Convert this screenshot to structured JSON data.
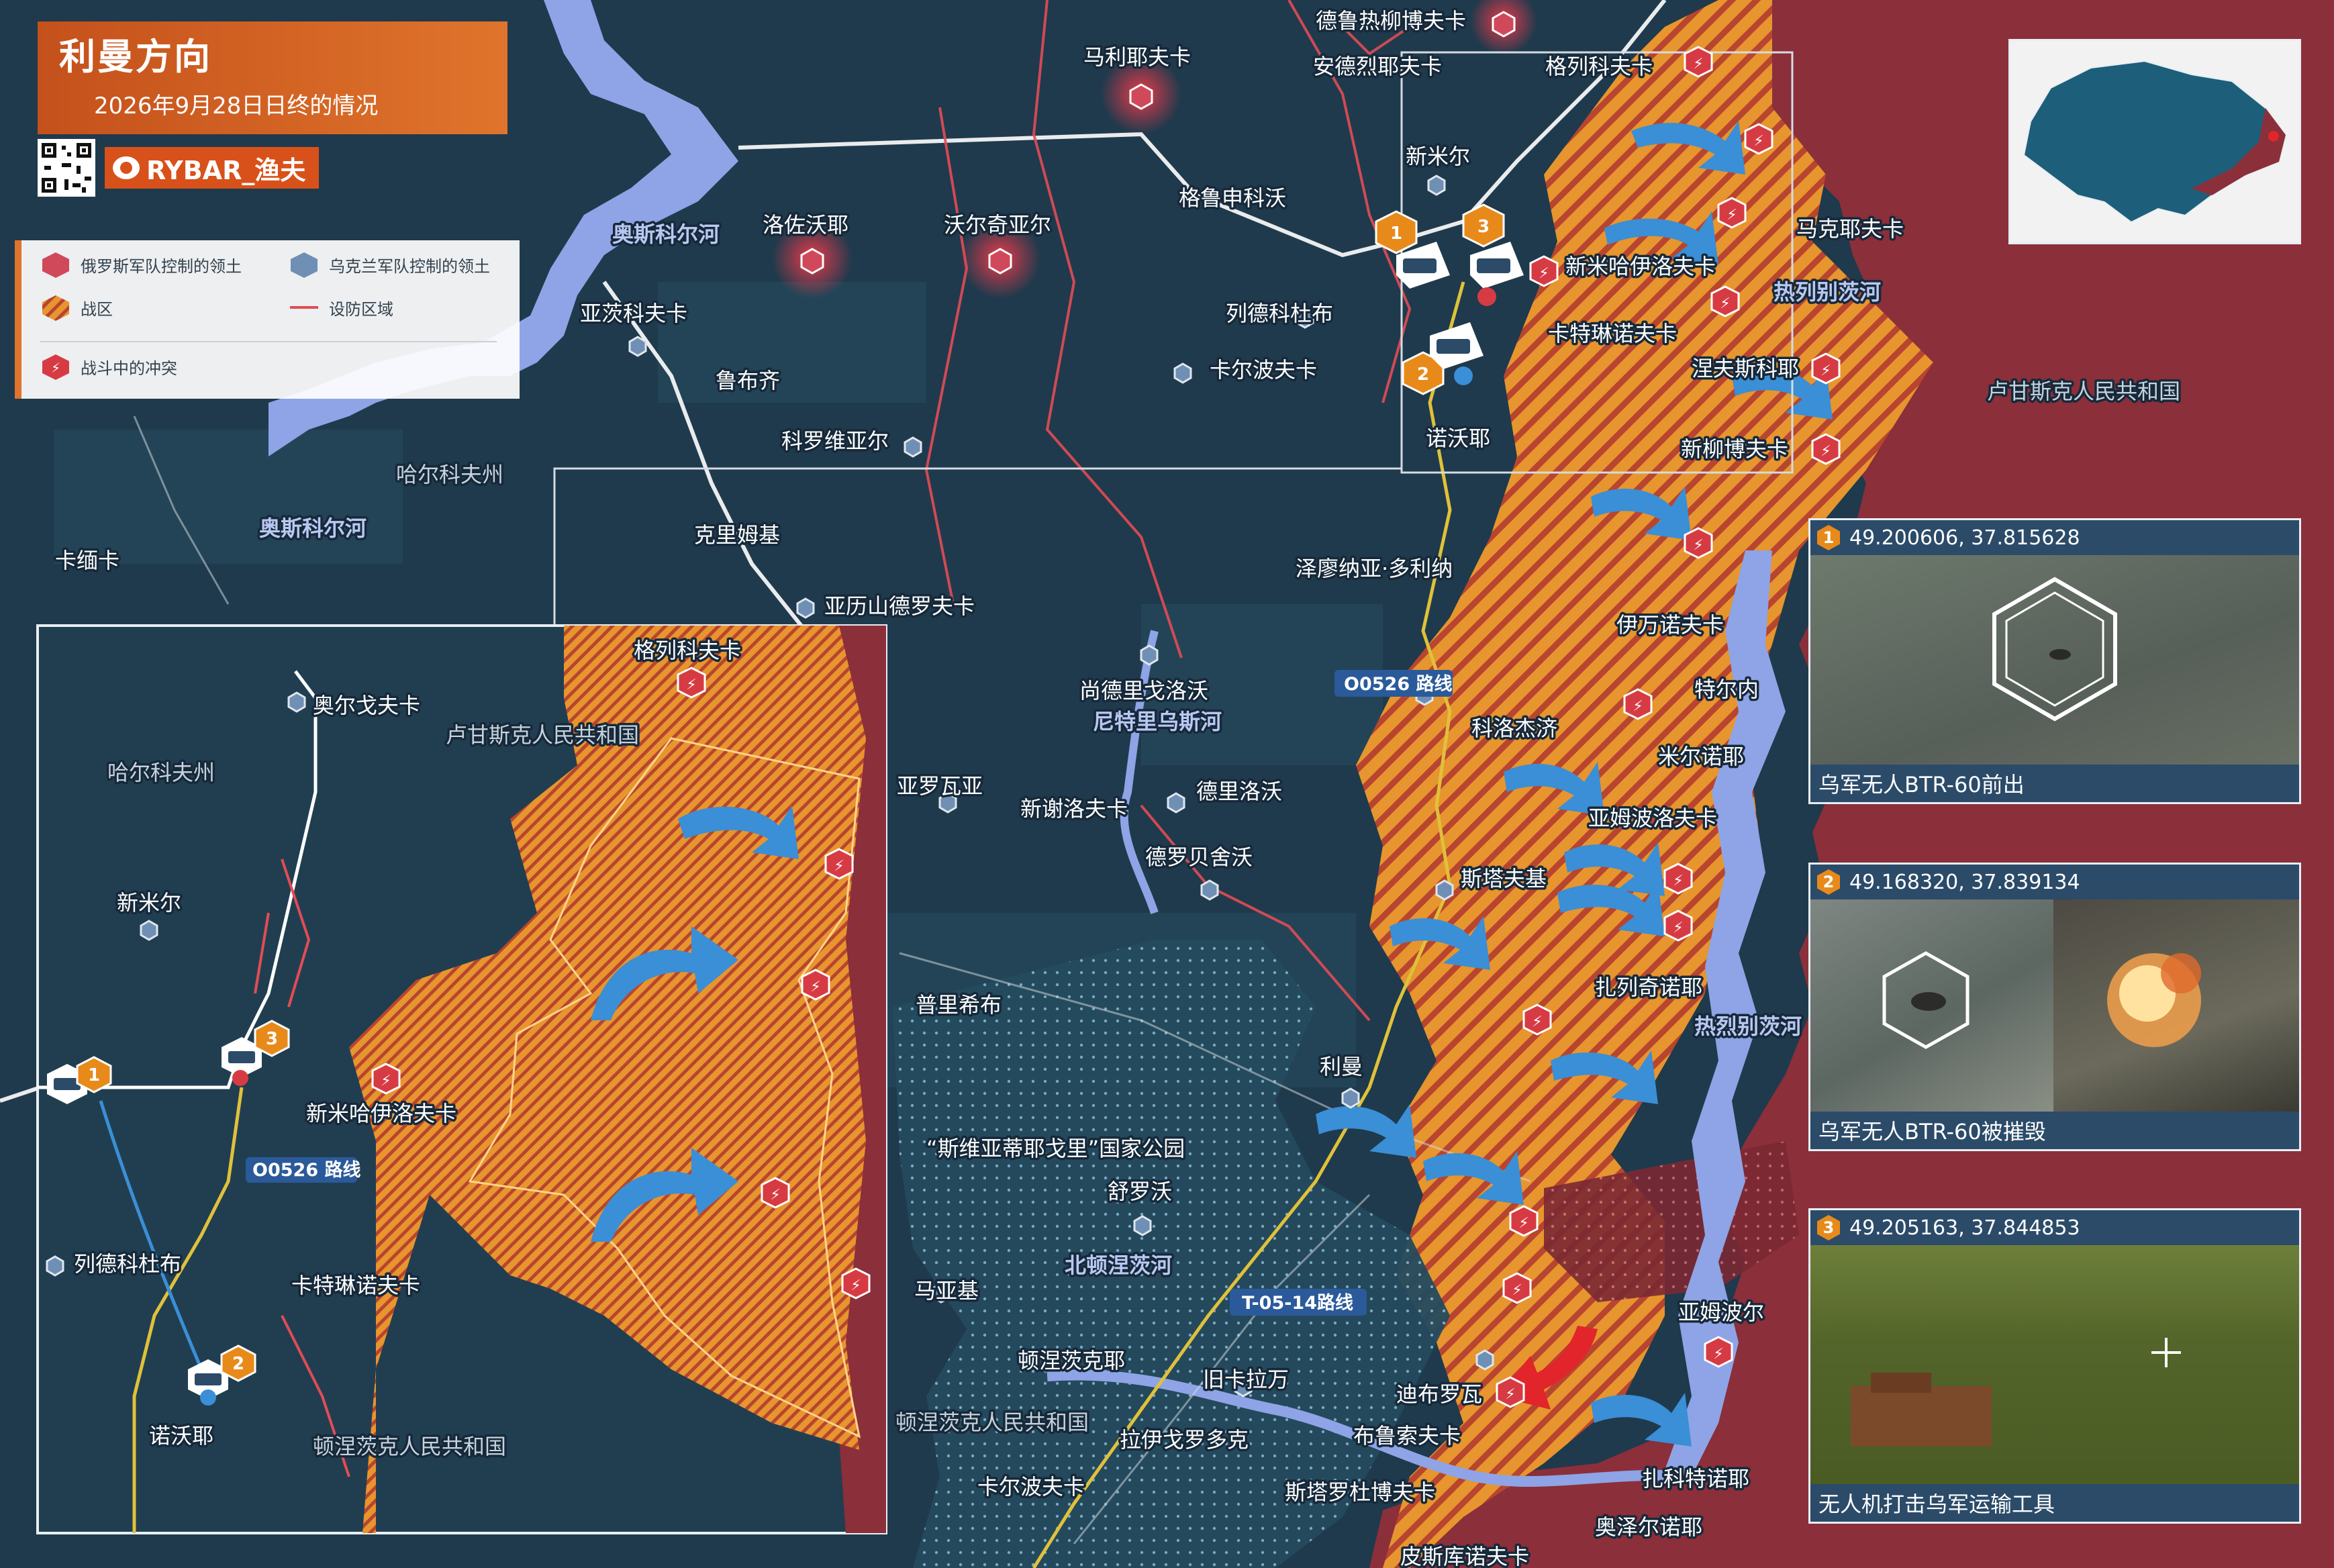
{
  "header": {
    "title": "利曼方向",
    "date": "2026年9月28日日终的情况",
    "brand": "RYBAR_渔夫"
  },
  "legend": {
    "russia_territory": "俄罗斯军队控制的领土",
    "ukraine_territory": "乌克兰军队控制的领土",
    "combat_zone": "战区",
    "defense_zone": "设防区域",
    "fighting": "战斗中的冲突"
  },
  "colors": {
    "russia": "#8b2f3a",
    "ukraine": "#1f3a4c",
    "combat": "#e7952e",
    "river": "#8ea4e6",
    "defense_line": "#e24c55",
    "accent": "#e0742c",
    "attack_arrow": "#3a8fd6",
    "counter_arrow": "#e2252b"
  },
  "map": {
    "places": {
      "derkulivka": "德鲁热柳博夫卡",
      "andriivka": "安德烈耶夫卡",
      "maliivka": "马利耶夫卡",
      "hrekivka": "格列科夫卡",
      "novomyr": "新米尔",
      "hrushivka": "格鲁申科沃",
      "lozovaya": "洛佐沃耶",
      "vovchansk": "沃尔奇亚尔",
      "yatsk": "亚茨科夫卡",
      "makiivka": "马克耶夫卡",
      "novomykh": "新米哈伊洛夫卡",
      "zherebets": "热列别茨河",
      "lyadkovo": "列德科杜布",
      "karpova": "卡尔波夫卡",
      "katerynivka": "卡特琳诺夫卡",
      "nevske": "涅夫斯科耶",
      "lnr": "卢甘斯克人民共和国",
      "novolubivka": "新柳博夫卡",
      "novo": "诺沃耶",
      "lubyanka": "鲁布齐",
      "kolomyi": "科罗维亚尔",
      "oskil": "奥斯科尔河",
      "kharkiv": "哈尔科夫州",
      "kramne": "克里姆基",
      "olek": "亚历山德罗夫卡",
      "kaneli": "卡缅卡",
      "zarichne": "泽廖纳亚·多利纳",
      "ivanivka": "伊万诺夫卡",
      "torske": "特尔内",
      "shandryholove": "尚德里戈洛沃",
      "nitrius": "尼特里乌斯河",
      "o0526": "O0526 路线",
      "kolodyazi": "科洛杰济",
      "mirne": "米尔诺耶",
      "yampolovka": "亚姆波洛夫卡",
      "yarova": "亚罗瓦亚",
      "novoselivka": "新谢洛夫卡",
      "derilove": "德里洛沃",
      "drobysheve": "德罗贝舍沃",
      "stavky": "斯塔夫基",
      "zarichne2": "扎列奇诺耶",
      "zherebets2": "热烈别茨河",
      "prishyb": "普里希布",
      "lyman": "利曼",
      "svyati": "“斯维亚蒂耶戈里”国家公园",
      "shchurove": "舒罗沃",
      "siverskyi": "北顿涅茨河",
      "mayaky": "马亚基",
      "t0514": "T-05-14路线",
      "yampil": "亚姆波尔",
      "donetsk_kr": "顿涅茨克耶",
      "stari_karavan": "旧卡拉万",
      "dibrova": "迪布罗瓦",
      "dpr": "顿涅茨克人民共和国",
      "rayhorodok": "拉伊戈罗多克",
      "bilohorivka": "布鲁索夫卡",
      "karpivka": "卡尔波夫卡",
      "staromayorske": "斯塔罗杜博夫卡",
      "serebrianka": "扎科特诺耶",
      "ozerne": "奥泽尔诺耶",
      "pyskunivka": "皮斯库诺夫卡",
      "oskil2": "奥斯科尔河",
      "inset_hrekivka": "格列科夫卡",
      "inset_orlovka": "奥尔戈夫卡",
      "inset_lnr": "卢甘斯克人民共和国",
      "inset_kharkiv": "哈尔科夫州",
      "inset_novomyr": "新米尔",
      "inset_novomykh": "新米哈伊洛夫卡",
      "inset_road": "O0526 路线",
      "inset_lyadkovo": "列德科杜布",
      "inset_katerynivka": "卡特琳诺夫卡",
      "inset_novo": "诺沃耶",
      "inset_dpr": "顿涅茨克人民共和国"
    },
    "markers": [
      "1",
      "2",
      "3"
    ]
  },
  "panels": [
    {
      "num": "1",
      "coords": "49.200606, 37.815628",
      "caption": "乌军无人BTR-60前出"
    },
    {
      "num": "2",
      "coords": "49.168320, 37.839134",
      "caption": "乌军无人BTR-60被摧毁"
    },
    {
      "num": "3",
      "coords": "49.205163, 37.844853",
      "caption": "无人机打击乌军运输工具"
    }
  ]
}
